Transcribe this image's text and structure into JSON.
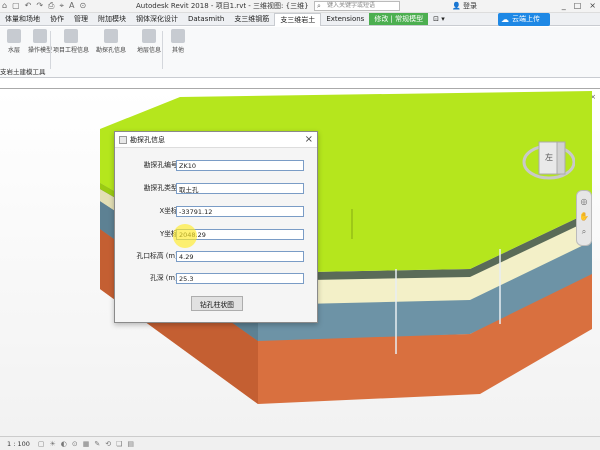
{
  "window": {
    "title": "Autodesk Revit 2018 -   项目1.rvt - 三维视图: {三维}",
    "search_placeholder": "键入关键字或短语",
    "login_label": "登录",
    "quick_access": [
      "⌂",
      "▢",
      "↶",
      "↷",
      "⎙",
      "⌖",
      "A",
      "⊙"
    ],
    "controls": [
      "_",
      "□",
      "×"
    ]
  },
  "tabs": [
    "体量和场地",
    "协作",
    "管理",
    "附加模块",
    "钢体深化设计",
    "Datasmith",
    "支三维钢筋",
    "支三维岩土",
    "Extensions",
    "修改 | 常规模型",
    "⊡ ▾"
  ],
  "cloud_button": "云端上传",
  "ribbon": {
    "buttons": [
      "水层",
      "操作模型",
      "项目工程信息",
      "勘探孔信息",
      "地层信息",
      "其他"
    ],
    "panel_title": "支岩土建模工具"
  },
  "viewport": {
    "controls": [
      "▢",
      "−",
      "□",
      "×"
    ],
    "viewcube_label": "左",
    "nav_icons": [
      "◎",
      "✋",
      "⌕"
    ]
  },
  "dialog": {
    "title": "勘探孔信息",
    "close": "×",
    "fields": [
      {
        "label": "勘探孔编号:",
        "value": "ZK10"
      },
      {
        "label": "勘探孔类型:",
        "value": "取土孔"
      },
      {
        "label": "X坐标:",
        "value": "-33791.12"
      },
      {
        "label": "Y坐标:",
        "value": "2048.29"
      },
      {
        "label": "孔口标高 (m):",
        "value": "4.29"
      },
      {
        "label": "孔深 (m):",
        "value": "25.3"
      }
    ],
    "action_button": "钻孔柱状图"
  },
  "statusbar": {
    "scale": "1 : 100",
    "icons": [
      "▢",
      "☀",
      "◐",
      "⊙",
      "▦",
      "✎",
      "⟲",
      "❏",
      "▤"
    ]
  }
}
